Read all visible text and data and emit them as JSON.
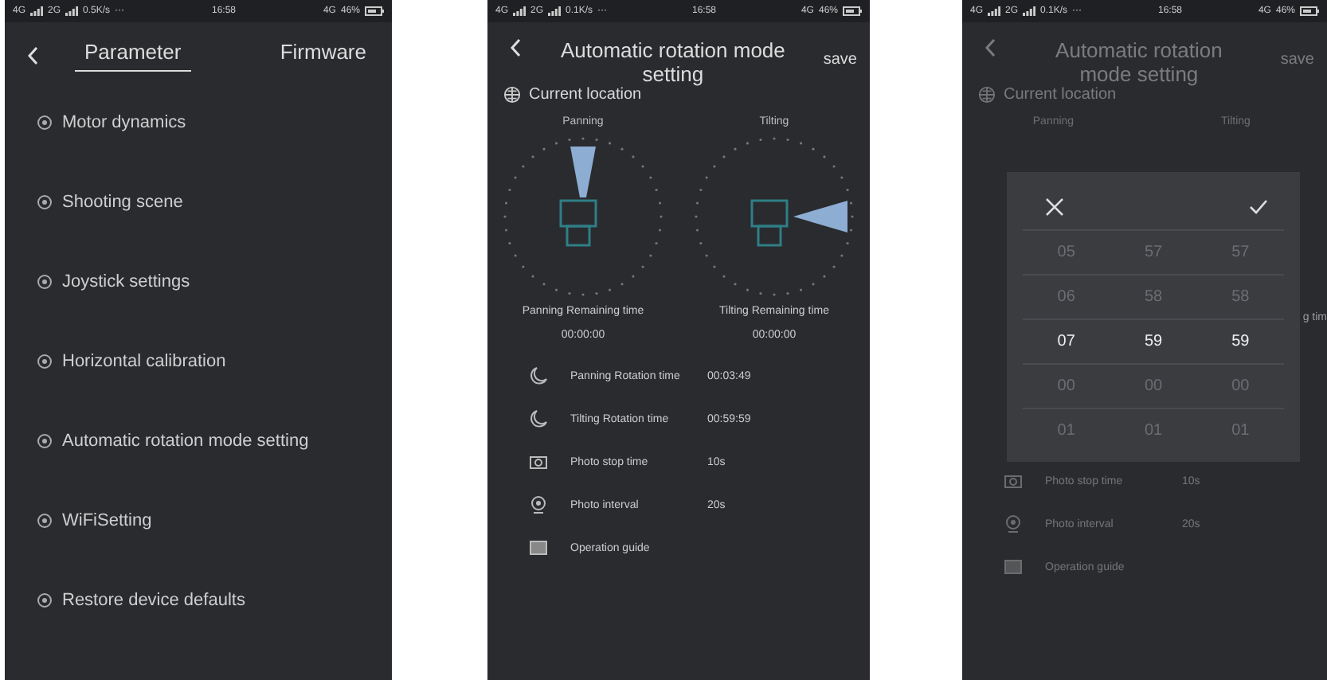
{
  "phones": [
    {
      "kind": "menu",
      "status": {
        "net_a": "4G",
        "net_b": "2G",
        "speed": "0.5K/s",
        "dots": "···",
        "time": "16:58",
        "net_c": "4G",
        "battery": "46%"
      },
      "tabs": [
        {
          "label": "Parameter",
          "selected": true
        },
        {
          "label": "Firmware",
          "selected": false
        }
      ],
      "items": [
        {
          "label": "Motor dynamics"
        },
        {
          "label": "Shooting scene"
        },
        {
          "label": "Joystick settings"
        },
        {
          "label": "Horizontal calibration"
        },
        {
          "label": "Automatic rotation mode setting"
        },
        {
          "label": "WiFiSetting"
        },
        {
          "label": "Restore device defaults"
        }
      ]
    },
    {
      "kind": "rotation",
      "dimmed": false,
      "status": {
        "net_a": "4G",
        "net_b": "2G",
        "speed": "0.1K/s",
        "dots": "···",
        "time": "16:58",
        "net_c": "4G",
        "battery": "46%"
      },
      "title": "Automatic rotation mode setting",
      "action": "save",
      "location": "Current location",
      "dials": [
        {
          "label": "Panning",
          "remaining_label": "Panning Remaining time",
          "remaining": "00:00:00"
        },
        {
          "label": "Tilting",
          "remaining_label": "Tilting Remaining time",
          "remaining": "00:00:00"
        }
      ],
      "settings": [
        {
          "kind": "duration",
          "label": "Panning Rotation time",
          "value": "00:03:49"
        },
        {
          "kind": "duration",
          "label": "Tilting Rotation time",
          "value": "00:59:59"
        },
        {
          "kind": "stop",
          "label": "Photo stop time",
          "value": "10s"
        },
        {
          "kind": "interval",
          "label": "Photo interval",
          "value": "20s"
        },
        {
          "kind": "guide",
          "label": "Operation guide"
        }
      ]
    },
    {
      "kind": "rotation",
      "dimmed": true,
      "status": {
        "net_a": "4G",
        "net_b": "2G",
        "speed": "0.1K/s",
        "dots": "···",
        "time": "16:58",
        "net_c": "4G",
        "battery": "46%"
      },
      "title": "Automatic rotation mode setting",
      "action": "save",
      "location": "Current location",
      "dials": [
        {
          "label": "Panning"
        },
        {
          "label": "Tilting"
        }
      ],
      "covered_text": "g tim",
      "picker": {
        "rows": [
          {
            "values": [
              "05",
              "57",
              "57"
            ],
            "selected": false
          },
          {
            "values": [
              "06",
              "58",
              "58"
            ],
            "selected": false
          },
          {
            "values": [
              "07",
              "59",
              "59"
            ],
            "selected": true
          },
          {
            "values": [
              "00",
              "00",
              "00"
            ],
            "selected": false
          },
          {
            "values": [
              "01",
              "01",
              "01"
            ],
            "selected": false
          }
        ]
      },
      "settings": [
        {
          "kind": "stop",
          "label": "Photo stop time",
          "value": "10s"
        },
        {
          "kind": "interval",
          "label": "Photo interval",
          "value": "20s"
        },
        {
          "kind": "guide",
          "label": "Operation guide"
        }
      ]
    }
  ]
}
